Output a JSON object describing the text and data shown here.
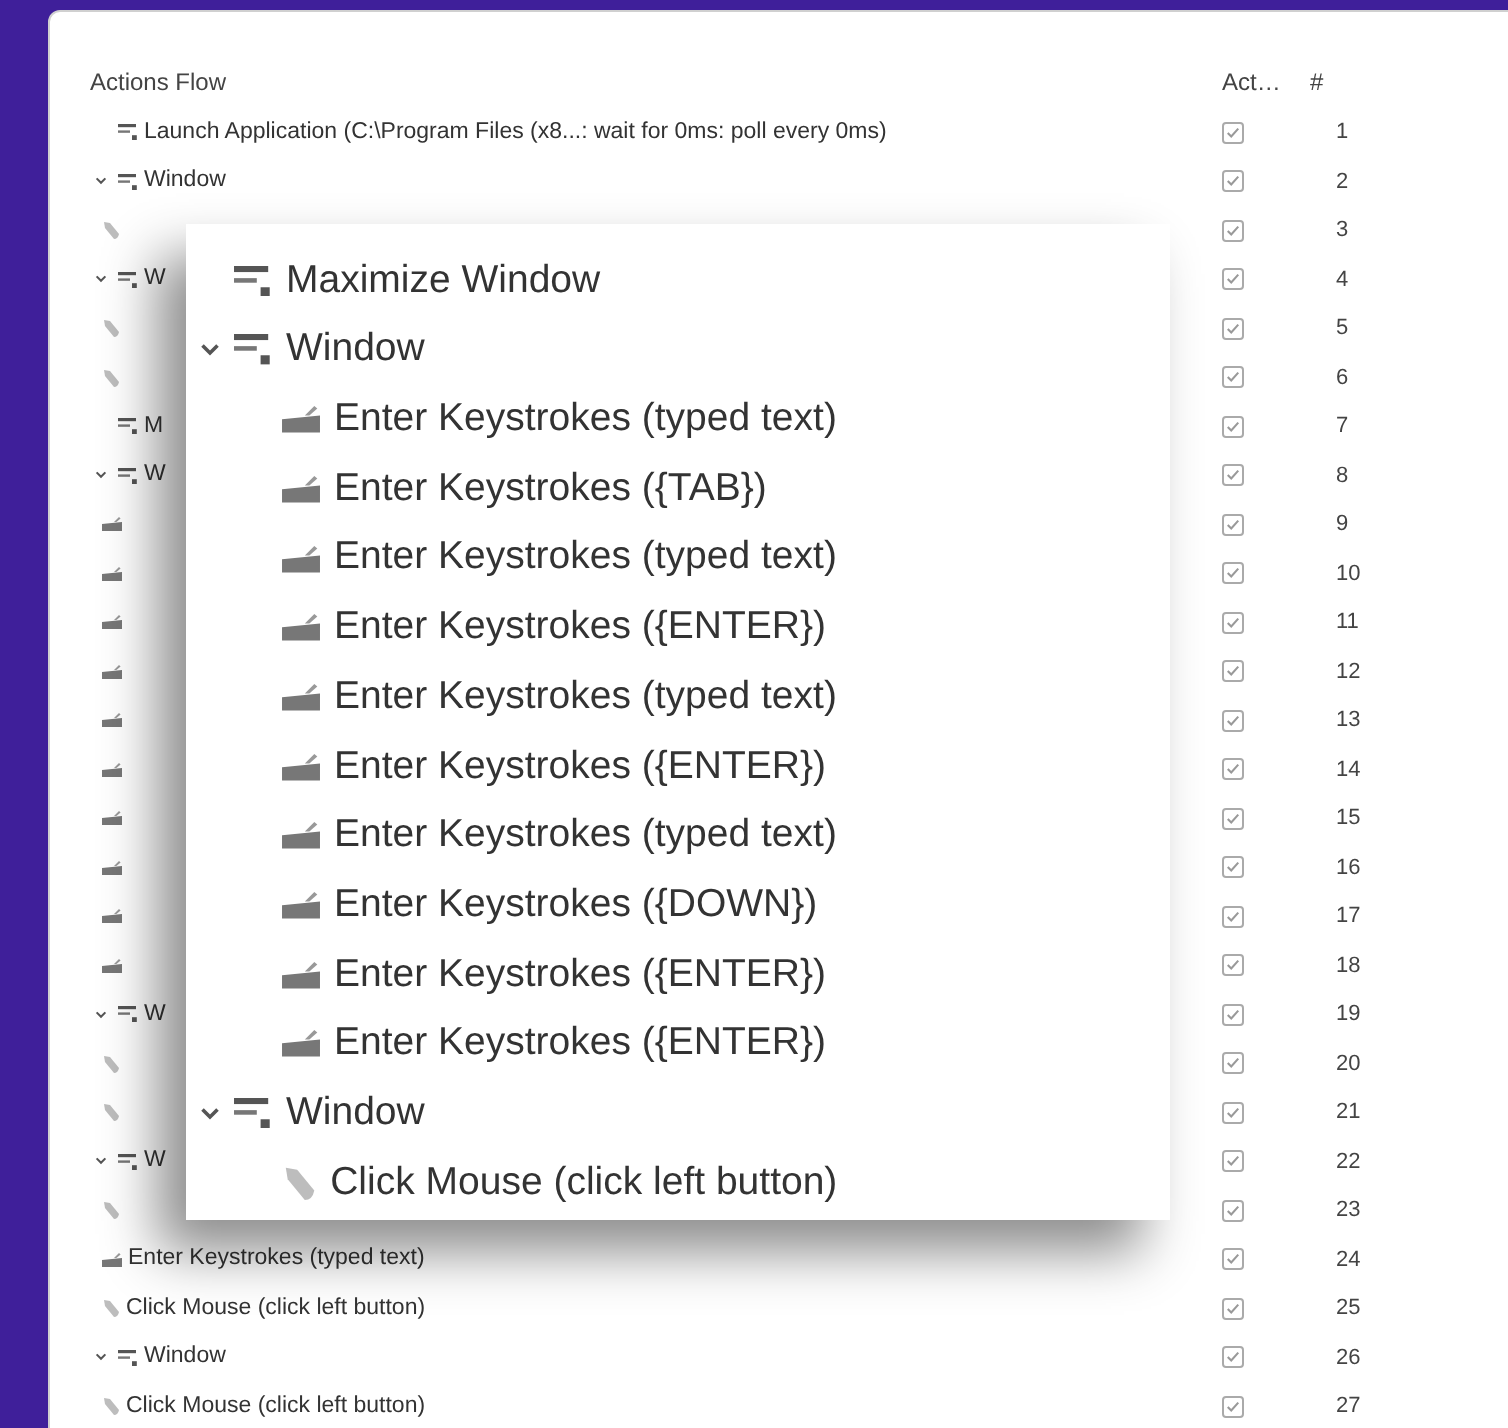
{
  "columns": {
    "actions": "Actions Flow",
    "active": "Act…",
    "number": "#"
  },
  "rows": [
    {
      "label": "Launch Application (C:\\Program Files (x8...: wait for 0ms: poll every 0ms)",
      "kind": "window",
      "active": true,
      "number": "1"
    },
    {
      "label": "Window",
      "kind": "window",
      "expanded": true,
      "active": true,
      "number": "2",
      "children": [
        {
          "kind": "mouse",
          "active": true,
          "number": "3"
        }
      ]
    },
    {
      "label": "W",
      "kind": "window",
      "expanded": true,
      "active": true,
      "number": "4",
      "children": [
        {
          "kind": "mouse",
          "active": true,
          "number": "5"
        },
        {
          "kind": "mouse",
          "active": true,
          "number": "6"
        }
      ]
    },
    {
      "label": "M",
      "kind": "window",
      "active": true,
      "number": "7"
    },
    {
      "label": "W",
      "kind": "window",
      "expanded": true,
      "active": true,
      "number": "8",
      "children": [
        {
          "kind": "keyboard",
          "active": true,
          "number": "9"
        },
        {
          "kind": "keyboard",
          "active": true,
          "number": "10"
        },
        {
          "kind": "keyboard",
          "active": true,
          "number": "11"
        },
        {
          "kind": "keyboard",
          "active": true,
          "number": "12"
        },
        {
          "kind": "keyboard",
          "active": true,
          "number": "13"
        },
        {
          "kind": "keyboard",
          "active": true,
          "number": "14"
        },
        {
          "kind": "keyboard",
          "active": true,
          "number": "15"
        },
        {
          "kind": "keyboard",
          "active": true,
          "number": "16"
        },
        {
          "kind": "keyboard",
          "active": true,
          "number": "17"
        },
        {
          "kind": "keyboard",
          "active": true,
          "number": "18"
        }
      ]
    },
    {
      "label": "W",
      "kind": "window",
      "expanded": true,
      "active": true,
      "number": "19",
      "children": [
        {
          "kind": "mouse",
          "active": true,
          "number": "20"
        },
        {
          "kind": "mouse",
          "active": true,
          "number": "21"
        }
      ]
    },
    {
      "label": "W",
      "kind": "window",
      "expanded": true,
      "active": true,
      "number": "22",
      "children": [
        {
          "kind": "mouse",
          "active": true,
          "number": "23"
        },
        {
          "label": "Enter Keystrokes (typed text)",
          "kind": "keyboard",
          "active": true,
          "number": "24"
        },
        {
          "label": "Click Mouse (click left button)",
          "kind": "mouse",
          "active": true,
          "number": "25"
        }
      ]
    },
    {
      "label": "Window",
      "kind": "window",
      "expanded": true,
      "active": true,
      "number": "26",
      "children": [
        {
          "label": "Click Mouse (click left button)",
          "kind": "mouse",
          "active": true,
          "number": "27"
        }
      ]
    }
  ],
  "zoom_callout": [
    {
      "label": "Maximize Window",
      "kind": "window"
    },
    {
      "label": "Window",
      "kind": "window",
      "expanded": true,
      "children": [
        {
          "label": "Enter Keystrokes (typed text)",
          "kind": "keyboard"
        },
        {
          "label": "Enter Keystrokes ({TAB})",
          "kind": "keyboard"
        },
        {
          "label": "Enter Keystrokes (typed text)",
          "kind": "keyboard"
        },
        {
          "label": "Enter Keystrokes ({ENTER})",
          "kind": "keyboard"
        },
        {
          "label": "Enter Keystrokes (typed text)",
          "kind": "keyboard"
        },
        {
          "label": "Enter Keystrokes ({ENTER})",
          "kind": "keyboard"
        },
        {
          "label": "Enter Keystrokes (typed text)",
          "kind": "keyboard"
        },
        {
          "label": "Enter Keystrokes ({DOWN})",
          "kind": "keyboard"
        },
        {
          "label": "Enter Keystrokes ({ENTER})",
          "kind": "keyboard"
        },
        {
          "label": "Enter Keystrokes ({ENTER})",
          "kind": "keyboard"
        }
      ]
    },
    {
      "label": "Window",
      "kind": "window",
      "expanded": true,
      "children": [
        {
          "label": "Click Mouse (click left button)",
          "kind": "mouse"
        }
      ]
    }
  ]
}
